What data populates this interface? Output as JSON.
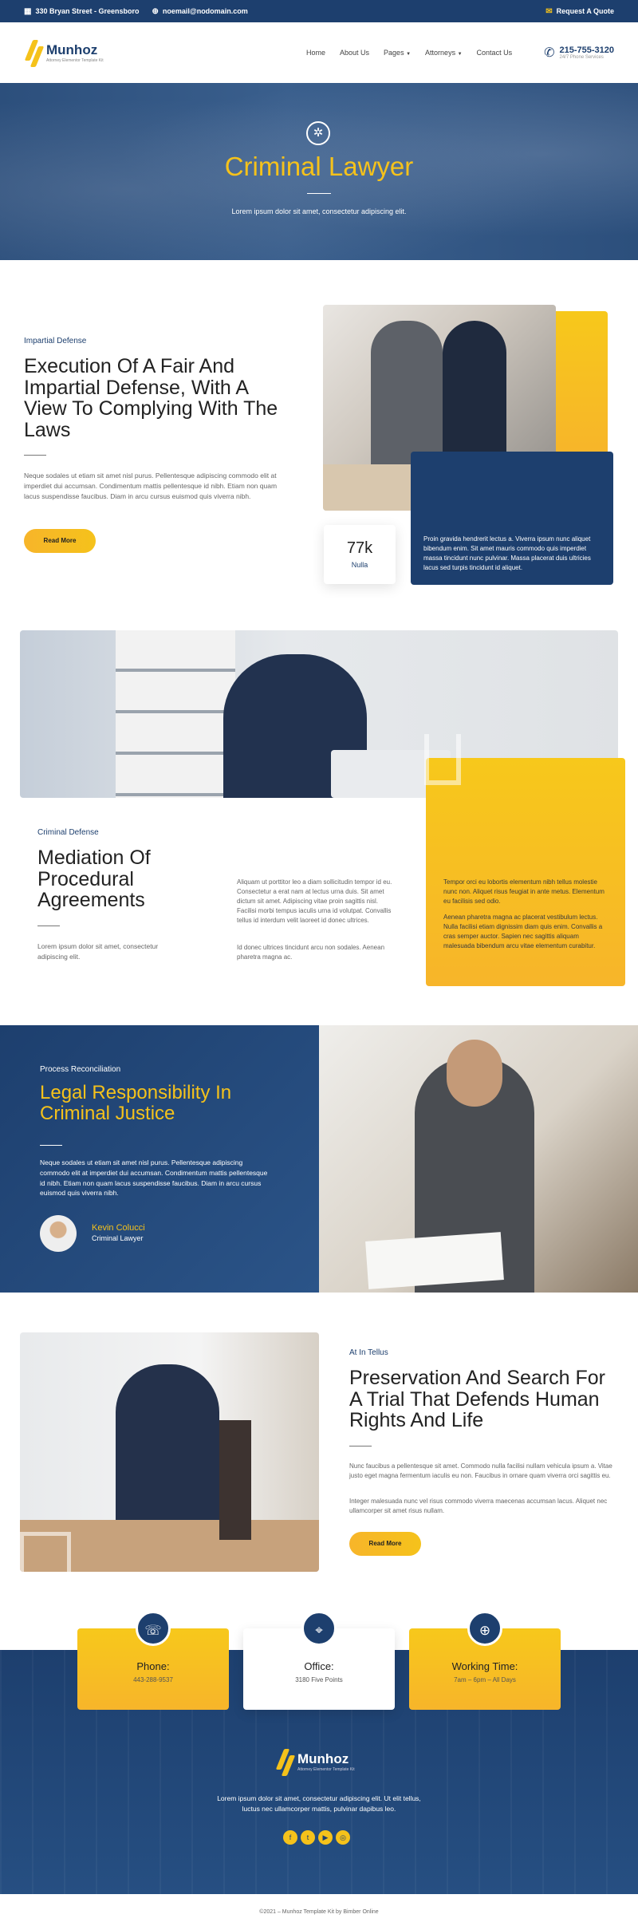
{
  "topbar": {
    "address": "330 Bryan Street - Greensboro",
    "email": "noemail@nodomain.com",
    "quote": "Request A Quote"
  },
  "header": {
    "logo_name": "Munhoz",
    "logo_tag": "Attorney Elementor Template Kit",
    "nav": [
      "Home",
      "About Us",
      "Pages",
      "Attorneys",
      "Contact Us"
    ],
    "phone": "215-755-3120",
    "phone_sub": "24/7 Phone Services"
  },
  "hero": {
    "title": "Criminal Lawyer",
    "subtitle": "Lorem ipsum dolor sit amet, consectetur adipiscing elit."
  },
  "sec1": {
    "eyebrow": "Impartial Defense",
    "title": "Execution Of A Fair And Impartial Defense, With A View To Complying With The Laws",
    "body": "Neque sodales ut etiam sit amet nisl purus. Pellentesque adipiscing commodo elit at imperdiet dui accumsan. Condimentum mattis pellentesque id nibh. Etiam non quam lacus suspendisse faucibus. Diam in arcu cursus euismod quis viverra nibh.",
    "button": "Read More",
    "stat_value": "77k",
    "stat_label": "Nulla",
    "blue_text": "Proin gravida hendrerit lectus a. Viverra ipsum nunc aliquet bibendum enim. Sit amet mauris commodo quis imperdiet massa tincidunt nunc pulvinar. Massa placerat duis ultricies lacus sed turpis tincidunt id aliquet."
  },
  "sec2": {
    "eyebrow": "Criminal Defense",
    "title": "Mediation Of Procedural Agreements",
    "body": "Lorem ipsum dolor sit amet, consectetur adipiscing elit.",
    "mid1": "Aliquam ut porttitor leo a diam sollicitudin tempor id eu. Consectetur a erat nam at lectus urna duis. Sit amet dictum sit amet. Adipiscing vitae proin sagittis nisl. Facilisi morbi tempus iaculis urna id volutpat. Convallis tellus id interdum velit laoreet id donec ultrices.",
    "mid2": "Id donec ultrices tincidunt arcu non sodales. Aenean pharetra magna ac.",
    "y1": "Tempor orci eu lobortis elementum nibh tellus molestie nunc non. Aliquet risus feugiat in ante metus. Elementum eu facilisis sed odio.",
    "y2": "Aenean pharetra magna ac placerat vestibulum lectus. Nulla facilisi etiam dignissim diam quis enim. Convallis a cras semper auctor. Sapien nec sagittis aliquam malesuada bibendum arcu vitae elementum curabitur."
  },
  "sec3": {
    "eyebrow": "Process Reconciliation",
    "title": "Legal Responsibility In Criminal Justice",
    "body": "Neque sodales ut etiam sit amet nisl purus. Pellentesque adipiscing commodo elit at imperdiet dui accumsan. Condimentum mattis pellentesque id nibh. Etiam non quam lacus suspendisse faucibus. Diam in arcu cursus euismod quis viverra nibh.",
    "person": "Kevin Colucci",
    "role": "Criminal Lawyer"
  },
  "sec4": {
    "eyebrow": "At In Tellus",
    "title": "Preservation And Search For A Trial That Defends Human Rights And Life",
    "body1": "Nunc faucibus a pellentesque sit amet. Commodo nulla facilisi nullam vehicula ipsum a. Vitae justo eget magna fermentum iaculis eu non. Faucibus in ornare quam viverra orci sagittis eu.",
    "body2": "Integer malesuada nunc vel risus commodo viverra maecenas accumsan lacus. Aliquet nec ullamcorper sit amet risus nullam.",
    "button": "Read More"
  },
  "cards": [
    {
      "title": "Phone:",
      "sub": "443-288-9537",
      "icon": "phone-icon"
    },
    {
      "title": "Office:",
      "sub": "3180 Five Points",
      "icon": "location-icon"
    },
    {
      "title": "Working Time:",
      "sub": "7am – 6pm – All Days",
      "icon": "globe-icon"
    }
  ],
  "footer": {
    "logo_name": "Munhoz",
    "logo_tag": "Attorney Elementor Template Kit",
    "text": "Lorem ipsum dolor sit amet, consectetur adipiscing elit. Ut elit tellus, luctus nec ullamcorper mattis, pulvinar dapibus leo.",
    "copy": "©2021 – Munhoz Template Kit by Bimber Online"
  },
  "colors": {
    "navy": "#1d3f6e",
    "yellow": "#f5c21b"
  }
}
